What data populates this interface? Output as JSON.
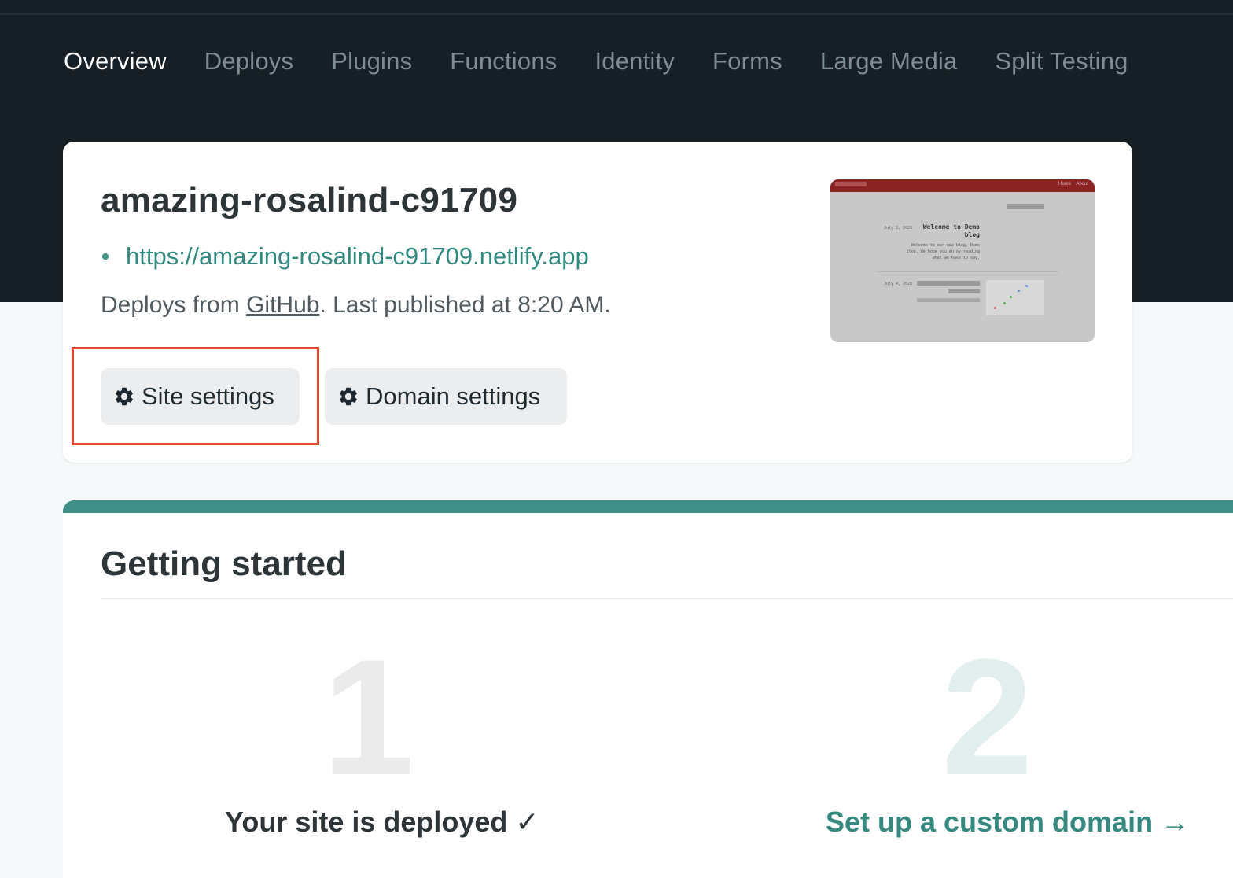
{
  "nav": {
    "items": [
      {
        "label": "Overview",
        "active": true
      },
      {
        "label": "Deploys"
      },
      {
        "label": "Plugins"
      },
      {
        "label": "Functions"
      },
      {
        "label": "Identity"
      },
      {
        "label": "Forms"
      },
      {
        "label": "Large Media"
      },
      {
        "label": "Split Testing"
      }
    ]
  },
  "site": {
    "name": "amazing-rosalind-c91709",
    "url": "https://amazing-rosalind-c91709.netlify.app",
    "deploy_prefix": "Deploys from ",
    "deploy_source": "GitHub",
    "deploy_suffix": ". Last published at 8:20 AM.",
    "buttons": {
      "site_settings": "Site settings",
      "domain_settings": "Domain settings"
    },
    "preview": {
      "nav_home": "Home",
      "nav_about": "About",
      "post1_date": "July 3, 2020",
      "post1_title": "Welcome to Demo blog",
      "post1_excerpt": "Welcome to our new blog. Demo blog. We hope you enjoy reading what we have to say.",
      "post2_date": "July 4, 2020"
    }
  },
  "getting_started": {
    "title": "Getting started",
    "steps": [
      {
        "number": "1",
        "label": "Your site is deployed ✓"
      },
      {
        "number": "2",
        "label": "Set up a custom domain →"
      }
    ]
  },
  "colors": {
    "topbar": "#161f25",
    "accent": "#3f8f86",
    "link": "#308a80",
    "highlight": "#e2472f"
  }
}
